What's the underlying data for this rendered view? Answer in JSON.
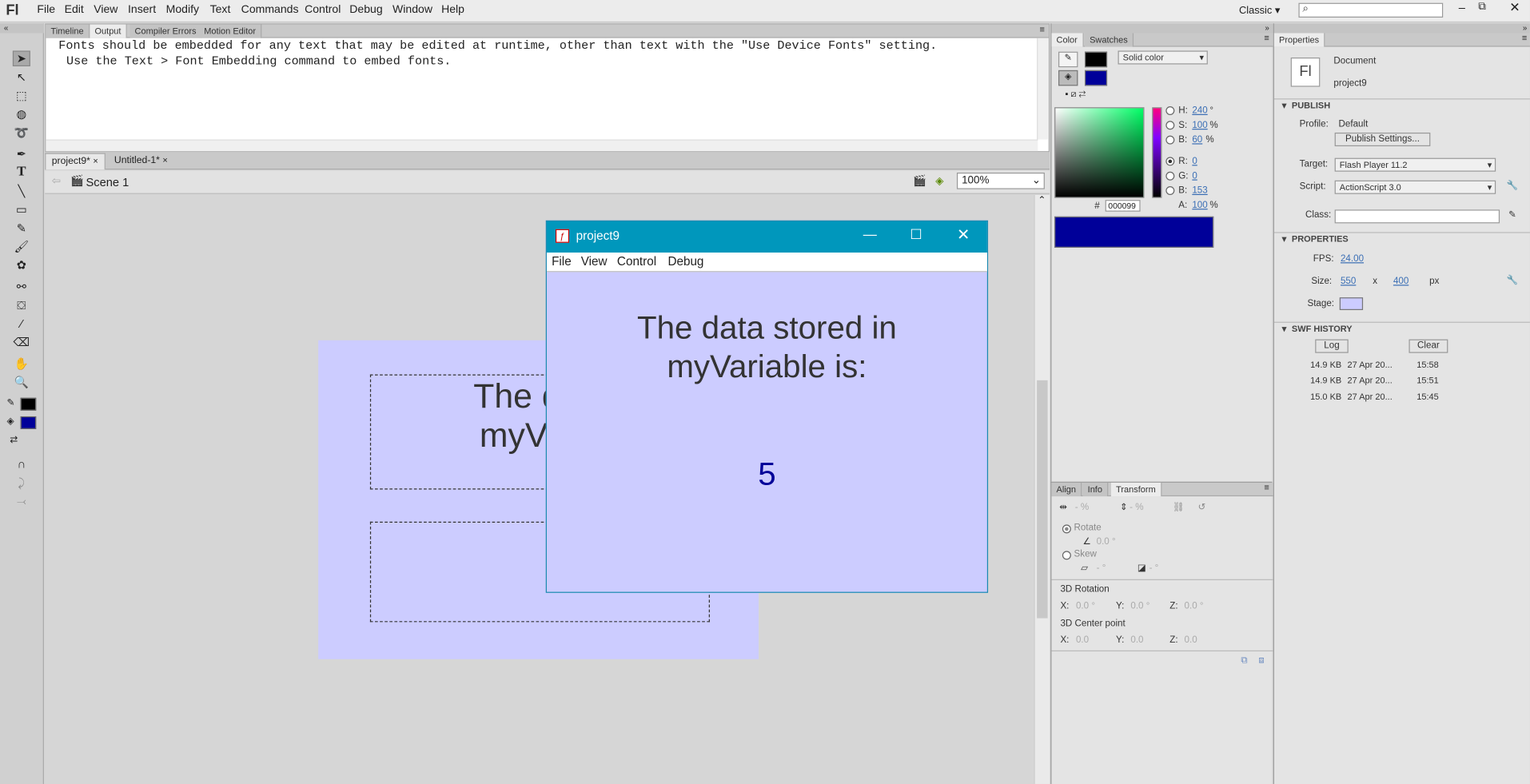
{
  "app": {
    "logo": "Fl",
    "workspace": "Classic"
  },
  "menu": [
    "File",
    "Edit",
    "View",
    "Insert",
    "Modify",
    "Text",
    "Commands",
    "Control",
    "Debug",
    "Window",
    "Help"
  ],
  "output_panel": {
    "tabs": [
      "Timeline",
      "Output",
      "Compiler Errors",
      "Motion Editor"
    ],
    "active": "Output",
    "lines": [
      "Fonts should be embedded for any text that may be edited at runtime, other than text with the \"Use Device Fonts\" setting.",
      "Use the Text > Font Embedding command to embed fonts."
    ]
  },
  "doc_tabs": [
    {
      "label": "project9*"
    },
    {
      "label": "Untitled-1*"
    }
  ],
  "scene": {
    "label": "Scene 1",
    "zoom": "100%"
  },
  "stage": {
    "text_line1": "The data",
    "text_line2": "myVaria"
  },
  "swf_window": {
    "title": "project9",
    "menu": [
      "File",
      "View",
      "Control",
      "Debug"
    ],
    "text_line1": "The data stored in",
    "text_line2": "myVariable is:",
    "value": "5",
    "bg": "#ccccff"
  },
  "color_panel": {
    "tabs": [
      "Color",
      "Swatches"
    ],
    "fill_type": "Solid color",
    "h_label": "H:",
    "h": "240",
    "h_unit": "°",
    "s_label": "S:",
    "s": "100",
    "s_unit": "%",
    "b_label": "B:",
    "b": "60",
    "b_unit": "%",
    "r_label": "R:",
    "r": "0",
    "g_label": "G:",
    "g": "0",
    "b2_label": "B:",
    "b2": "153",
    "a_label": "A:",
    "a": "100",
    "a_unit": "%",
    "hex_prefix": "#",
    "hex": "000099",
    "fill_color": "#000099"
  },
  "transform_panel": {
    "tabs": [
      "Align",
      "Info",
      "Transform"
    ],
    "width_pct": "- %",
    "height_pct": "- %",
    "rotate_label": "Rotate",
    "rotate_val": "0.0 °",
    "skew_label": "Skew",
    "skew_h": "- °",
    "skew_v": "- °",
    "rot3d_label": "3D Rotation",
    "x_label": "X:",
    "y_label": "Y:",
    "z_label": "Z:",
    "rx": "0.0 °",
    "ry": "0.0 °",
    "rz": "0.0 °",
    "center_label": "3D Center point",
    "cx": "0.0",
    "cy": "0.0",
    "cz": "0.0"
  },
  "properties": {
    "tab": "Properties",
    "doc_type": "Document",
    "doc_name": "project9",
    "doc_icon": "Fl",
    "publish_header": "PUBLISH",
    "profile_label": "Profile:",
    "profile": "Default",
    "publish_settings": "Publish Settings...",
    "target_label": "Target:",
    "target": "Flash Player 11.2",
    "script_label": "Script:",
    "script": "ActionScript 3.0",
    "class_label": "Class:",
    "props_header": "PROPERTIES",
    "fps_label": "FPS:",
    "fps": "24.00",
    "size_label": "Size:",
    "width": "550",
    "x": "x",
    "height": "400",
    "px": "px",
    "stage_label": "Stage:",
    "stage_color": "#ccccff",
    "history_header": "SWF HISTORY",
    "log_btn": "Log",
    "clear_btn": "Clear",
    "history": [
      {
        "size": "14.9 KB",
        "date": "27 Apr 20...",
        "time": "15:58"
      },
      {
        "size": "14.9 KB",
        "date": "27 Apr 20...",
        "time": "15:51"
      },
      {
        "size": "15.0 KB",
        "date": "27 Apr 20...",
        "time": "15:45"
      }
    ]
  }
}
